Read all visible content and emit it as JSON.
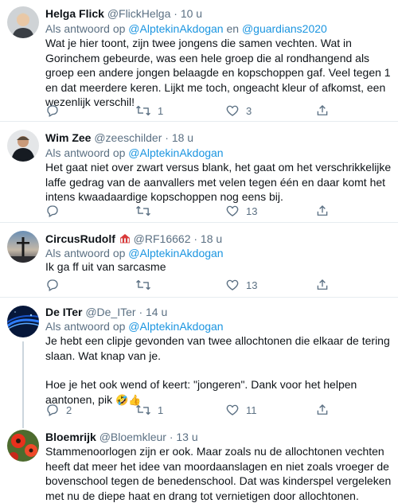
{
  "tweets": [
    {
      "name": "Helga Flick",
      "handle": "@FlickHelga",
      "time": "· 10 u",
      "reply_prefix": "Als antwoord op ",
      "reply_to_1": "@AlptekinAkdogan",
      "reply_join": " en ",
      "reply_to_2": "@guardians2020",
      "text": "Wat je hier toont, zijn twee jongens die samen vechten. Wat in Gorinchem gebeurde, was een hele groep die al rondhangend als groep een andere jongen belaagde en kopschoppen gaf. Veel tegen 1 en dat meerdere keren. Lijkt me toch, ongeacht kleur of afkomst, een wezenlijk verschil!",
      "replies": "",
      "retweets": "1",
      "likes": "3"
    },
    {
      "name": "Wim Zee",
      "handle": "@zeeschilder",
      "time": "· 18 u",
      "reply_prefix": "Als antwoord op ",
      "reply_to_1": "@AlptekinAkdogan",
      "text": "Het gaat niet over zwart versus blank, het gaat om het verschrikkelijke laffe gedrag van de aanvallers met velen tegen één en daar komt het intens kwaadaardige kopschoppen nog eens bij.",
      "replies": "",
      "retweets": "",
      "likes": "13"
    },
    {
      "name": "CircusRudolf",
      "handle": "@RF16662",
      "time": "· 18 u",
      "reply_prefix": "Als antwoord op ",
      "reply_to_1": "@AlptekinAkdogan",
      "text": "Ik ga ff uit van sarcasme",
      "replies": "",
      "retweets": "",
      "likes": "13"
    },
    {
      "name": "De ITer",
      "handle": "@De_ITer",
      "time": "· 14 u",
      "reply_prefix": "Als antwoord op ",
      "reply_to_1": "@AlptekinAkdogan",
      "text_1": "Je hebt een clipje gevonden van twee allochtonen die elkaar de tering slaan. Wat knap van je.",
      "text_2": "Hoe je het ook wend of keert: \"jongeren\". Dank voor het helpen aantonen, pik",
      "emoji": "🤣👍",
      "replies": "2",
      "retweets": "1",
      "likes": "11"
    },
    {
      "name": "Bloemrijk",
      "handle": "@Bloemkleur",
      "time": "· 13 u",
      "text": "Stammenoorlogen zijn er ook. Maar zoals nu de allochtonen vechten heeft dat meer het idee van moordaanslagen en niet zoals vroeger de bovenschool tegen de benedenschool. Dat was kinderspel vergeleken met  nu de diepe haat en drang tot vernietigen door allochtonen."
    }
  ],
  "colors": {
    "link": "#1b95e0",
    "muted": "#5b7083",
    "divider": "#e6ecf0"
  }
}
